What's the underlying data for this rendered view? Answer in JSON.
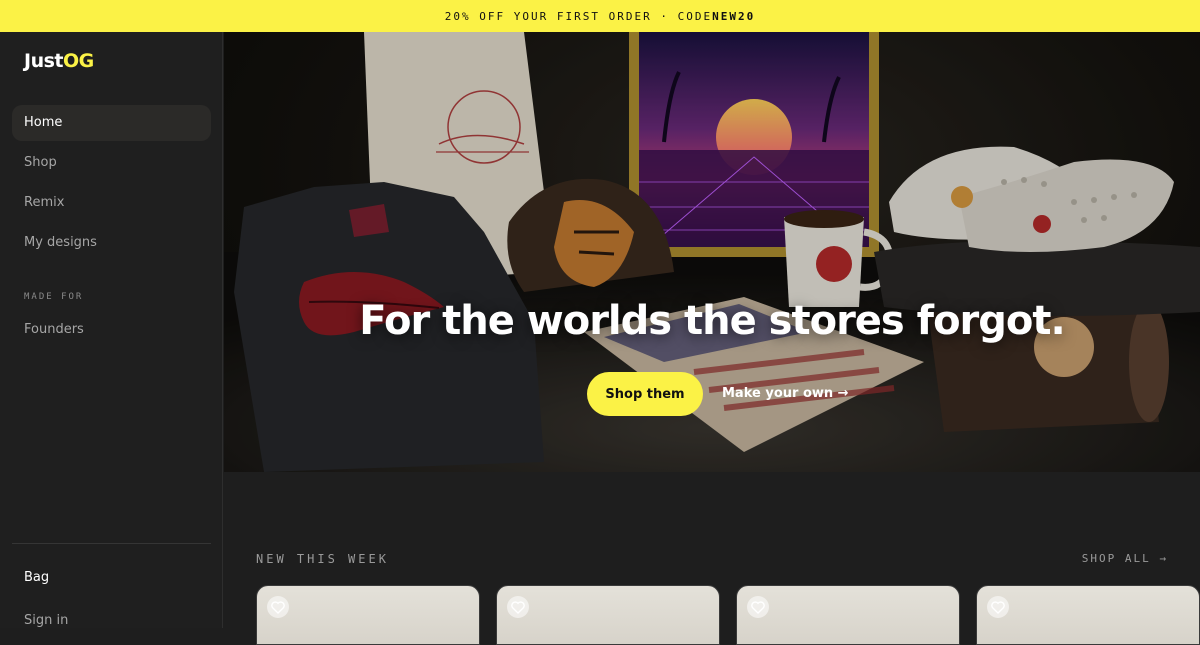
{
  "promo": {
    "text": "20% OFF YOUR FIRST ORDER · CODE ",
    "code": "NEW20"
  },
  "brand": {
    "name_a": "Just",
    "name_b": "OG",
    "accent": "#fbf246"
  },
  "sidebar": {
    "items": [
      {
        "label": "Home",
        "active": true
      },
      {
        "label": "Shop"
      },
      {
        "label": "Remix"
      },
      {
        "label": "My designs"
      }
    ],
    "section_label": "MADE FOR",
    "section_items": [
      {
        "label": "Founders"
      }
    ],
    "bag_label": "Bag",
    "signin_label": "Sign in"
  },
  "hero": {
    "title": "For the worlds the stores forgot.",
    "primary_button": "Shop them",
    "secondary_link": "Make your own →"
  },
  "new_this_week": {
    "label": "NEW THIS WEEK",
    "shop_all": "SHOP ALL →",
    "cards": [
      {
        "icon": "heart-icon"
      },
      {
        "icon": "heart-icon"
      },
      {
        "icon": "heart-icon"
      },
      {
        "icon": "heart-icon"
      }
    ]
  }
}
